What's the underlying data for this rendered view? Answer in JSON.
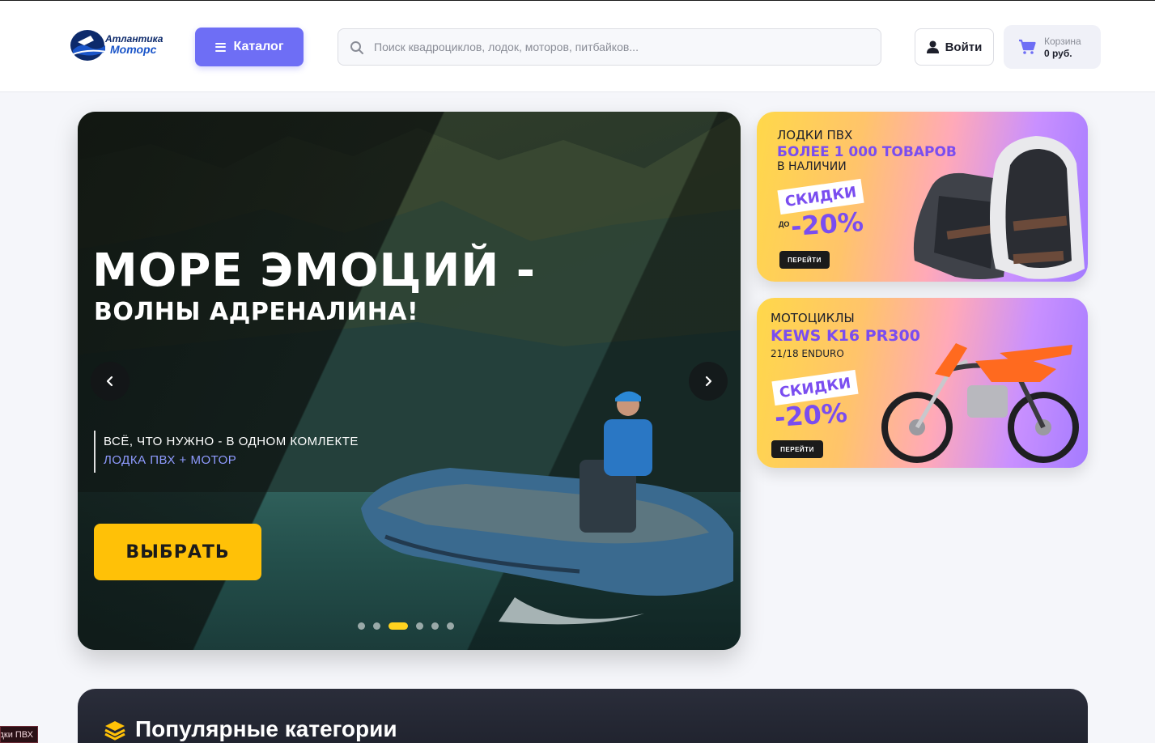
{
  "header": {
    "logo": {
      "line1": "Атлантика",
      "line2": "Моторс"
    },
    "catalog_label": "Каталог",
    "search_placeholder": "Поиск квадроциклов, лодок, моторов, питбайков...",
    "login_label": "Войти",
    "cart": {
      "label": "Корзина",
      "total": "0 руб."
    }
  },
  "hero": {
    "title_line1": "МОРЕ ЭМОЦИЙ -",
    "title_line2": "ВОЛНЫ АДРЕНАЛИНА!",
    "subtitle_line1": "ВСЁ, ЧТО НУЖНО - В ОДНОМ КОМЛЕКТЕ",
    "subtitle_line2": "ЛОДКА ПВХ + МОТОР",
    "cta_label": "ВЫБРАТЬ",
    "slide_count": 6,
    "active_slide": 3
  },
  "promos": [
    {
      "category": "ЛОДКИ ПВХ",
      "headline": "БОЛЕЕ 1 000 ТОВАРОВ",
      "subline": "В НАЛИЧИИ",
      "sale_label": "СКИДКИ",
      "prefix": "ДО",
      "discount": "-20%",
      "button_label": "ПЕРЕЙТИ"
    },
    {
      "category": "МОТОЦИКЛЫ",
      "headline": "KEWS K16 PR300",
      "subline": "21/18 ENDURO",
      "sale_label": "СКИДКИ",
      "discount": "-20%",
      "button_label": "ПЕРЕЙТИ"
    }
  ],
  "categories": {
    "title": "Популярные категории"
  },
  "tooltip": "дки ПВХ",
  "colors": {
    "accent": "#6e6ef5",
    "cta_yellow": "#ffc107",
    "promo_purple": "#7a4df0",
    "dark_section": "#1f222d"
  }
}
